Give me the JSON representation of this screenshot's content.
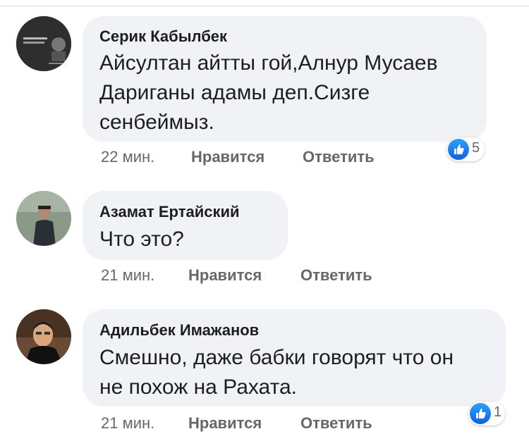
{
  "comments": [
    {
      "author": "Серик Кабылбек",
      "lines": [
        "Айсултан айтты гой,Алнур Мусаев",
        "Дариганы адамы деп.Сизге",
        "сенбеймыз."
      ],
      "time": "22 мин.",
      "like_label": "Нравится",
      "reply_label": "Ответить",
      "reaction_count": "5"
    },
    {
      "author": "Азамат Ертайский",
      "lines": [
        "Что это?"
      ],
      "time": "21 мин.",
      "like_label": "Нравится",
      "reply_label": "Ответить"
    },
    {
      "author": "Адильбек Имажанов",
      "lines": [
        "Смешно, даже бабки говорят что он",
        "не похож на Рахата."
      ],
      "time": "21 мин.",
      "like_label": "Нравится",
      "reply_label": "Ответить",
      "reaction_count": "1"
    }
  ],
  "colors": {
    "bubble": "#f0f2f5",
    "text": "#1c1e21",
    "meta": "#65676b",
    "like_blue": "#1877f2"
  },
  "icons": [
    "avatar",
    "like-icon"
  ]
}
